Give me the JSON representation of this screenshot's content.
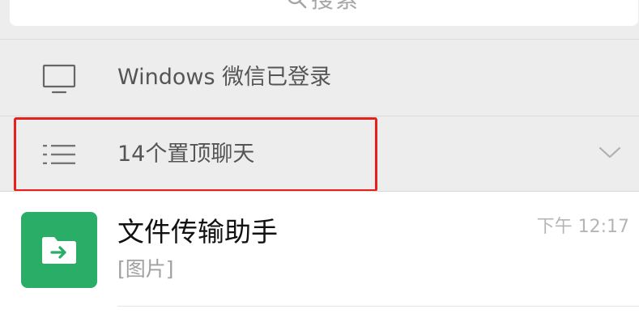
{
  "search": {
    "label": "搜索"
  },
  "windows_login": {
    "label": "Windows 微信已登录",
    "icon": "monitor-icon"
  },
  "pinned": {
    "label": "14个置顶聊天",
    "icon": "list-icon",
    "expand_icon": "chevron-down-icon"
  },
  "chats": [
    {
      "title": "文件传输助手",
      "preview": "[图片]",
      "time": "下午 12:17",
      "avatar_icon": "folder-arrow-icon",
      "avatar_color": "#2aae67"
    }
  ],
  "colors": {
    "highlight": "#e8201c",
    "section_bg": "#ededed",
    "accent_green": "#2aae67"
  }
}
